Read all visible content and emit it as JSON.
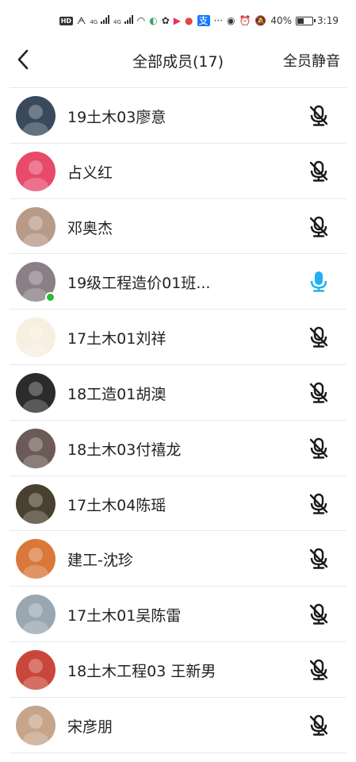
{
  "status_bar": {
    "hd_label": "HD",
    "net1": "4G",
    "net2": "4G",
    "more": "···",
    "battery_text": "40%",
    "time": "3:19"
  },
  "nav": {
    "title": "全部成员(17)",
    "mute_all_label": "全员静音"
  },
  "members": [
    {
      "name": "19土木03廖意",
      "mic": "muted",
      "avatar_color": "#3a4a5c",
      "online": false
    },
    {
      "name": "占义红",
      "mic": "muted",
      "avatar_color": "#e84a6a",
      "online": false
    },
    {
      "name": "邓奥杰",
      "mic": "muted",
      "avatar_color": "#b89a88",
      "online": false
    },
    {
      "name": "19级工程造价01班...",
      "mic": "active",
      "avatar_color": "#8a7f86",
      "online": true
    },
    {
      "name": "17土木01刘祥",
      "mic": "muted",
      "avatar_color": "#f7efe0",
      "online": false
    },
    {
      "name": "18工造01胡澳",
      "mic": "muted",
      "avatar_color": "#2b2b2b",
      "online": false
    },
    {
      "name": "18土木03付禧龙",
      "mic": "muted",
      "avatar_color": "#6b5a55",
      "online": false
    },
    {
      "name": "17土木04陈瑶",
      "mic": "muted",
      "avatar_color": "#4a4030",
      "online": false
    },
    {
      "name": "建工-沈珍",
      "mic": "muted",
      "avatar_color": "#d9783a",
      "online": false
    },
    {
      "name": "17土木01吴陈雷",
      "mic": "muted",
      "avatar_color": "#9aa7b3",
      "online": false
    },
    {
      "name": "18土木工程03 王新男",
      "mic": "muted",
      "avatar_color": "#c9473a",
      "online": false
    },
    {
      "name": "宋彦朋",
      "mic": "muted",
      "avatar_color": "#c7a58a",
      "online": false
    }
  ],
  "colors": {
    "mic_muted": "#1a1a1a",
    "mic_active": "#1fb1f0",
    "online": "#2eb82e"
  }
}
